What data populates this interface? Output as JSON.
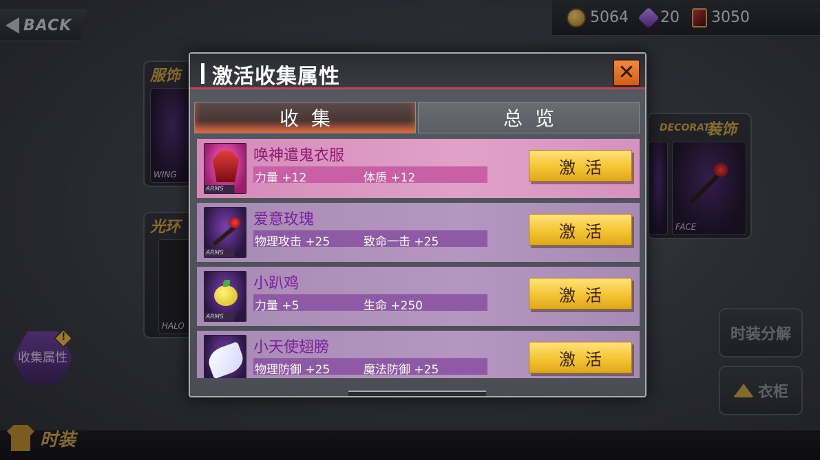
{
  "back_button": {
    "label": "BACK"
  },
  "currency": [
    {
      "icon": "coin-icon",
      "value": "5064"
    },
    {
      "icon": "gem-icon",
      "value": "20"
    },
    {
      "icon": "card-icon",
      "value": "3050"
    }
  ],
  "background": {
    "left_panel_title": "服饰",
    "left_slot_tag": "WING",
    "left_panel2_title": "光环",
    "left_slot2_tag": "HALO",
    "right_panel_title_en": "DECORATE",
    "right_panel_title": "装饰",
    "right_slot_tag": "FACE",
    "collect_button_label": "收集属性",
    "collect_alert": "!",
    "side_buttons": [
      "时装分解",
      "衣柜"
    ],
    "bottom_tab_label": "时装"
  },
  "dialog": {
    "title": "激活收集属性",
    "close_label": "✕",
    "tabs": [
      {
        "label": "收集",
        "active": true
      },
      {
        "label": "总览",
        "active": false
      }
    ],
    "items": [
      {
        "name": "唤神遣鬼衣服",
        "tag": "ARMS",
        "icon": "robe-icon",
        "highlight": true,
        "stats": [
          "力量 +12",
          "体质 +12"
        ],
        "button": "激活"
      },
      {
        "name": "爱意玫瑰",
        "tag": "ARMS",
        "icon": "rose-icon",
        "highlight": false,
        "stats": [
          "物理攻击 +25",
          "致命一击 +25"
        ],
        "button": "激活"
      },
      {
        "name": "小趴鸡",
        "tag": "ARMS",
        "icon": "chick-icon",
        "highlight": false,
        "stats": [
          "力量 +5",
          "生命 +250"
        ],
        "button": "激活"
      },
      {
        "name": "小天使翅膀",
        "tag": "",
        "icon": "wing-icon",
        "highlight": false,
        "stats": [
          "物理防御 +25",
          "魔法防御 +25"
        ],
        "button": "激活"
      }
    ]
  },
  "colors": {
    "accent_red": "#c2434f",
    "close_orange": "#f08a3c",
    "button_gold": "#f4c433",
    "row_purple": "#b596c0",
    "row_pink": "#e0a1c8"
  }
}
